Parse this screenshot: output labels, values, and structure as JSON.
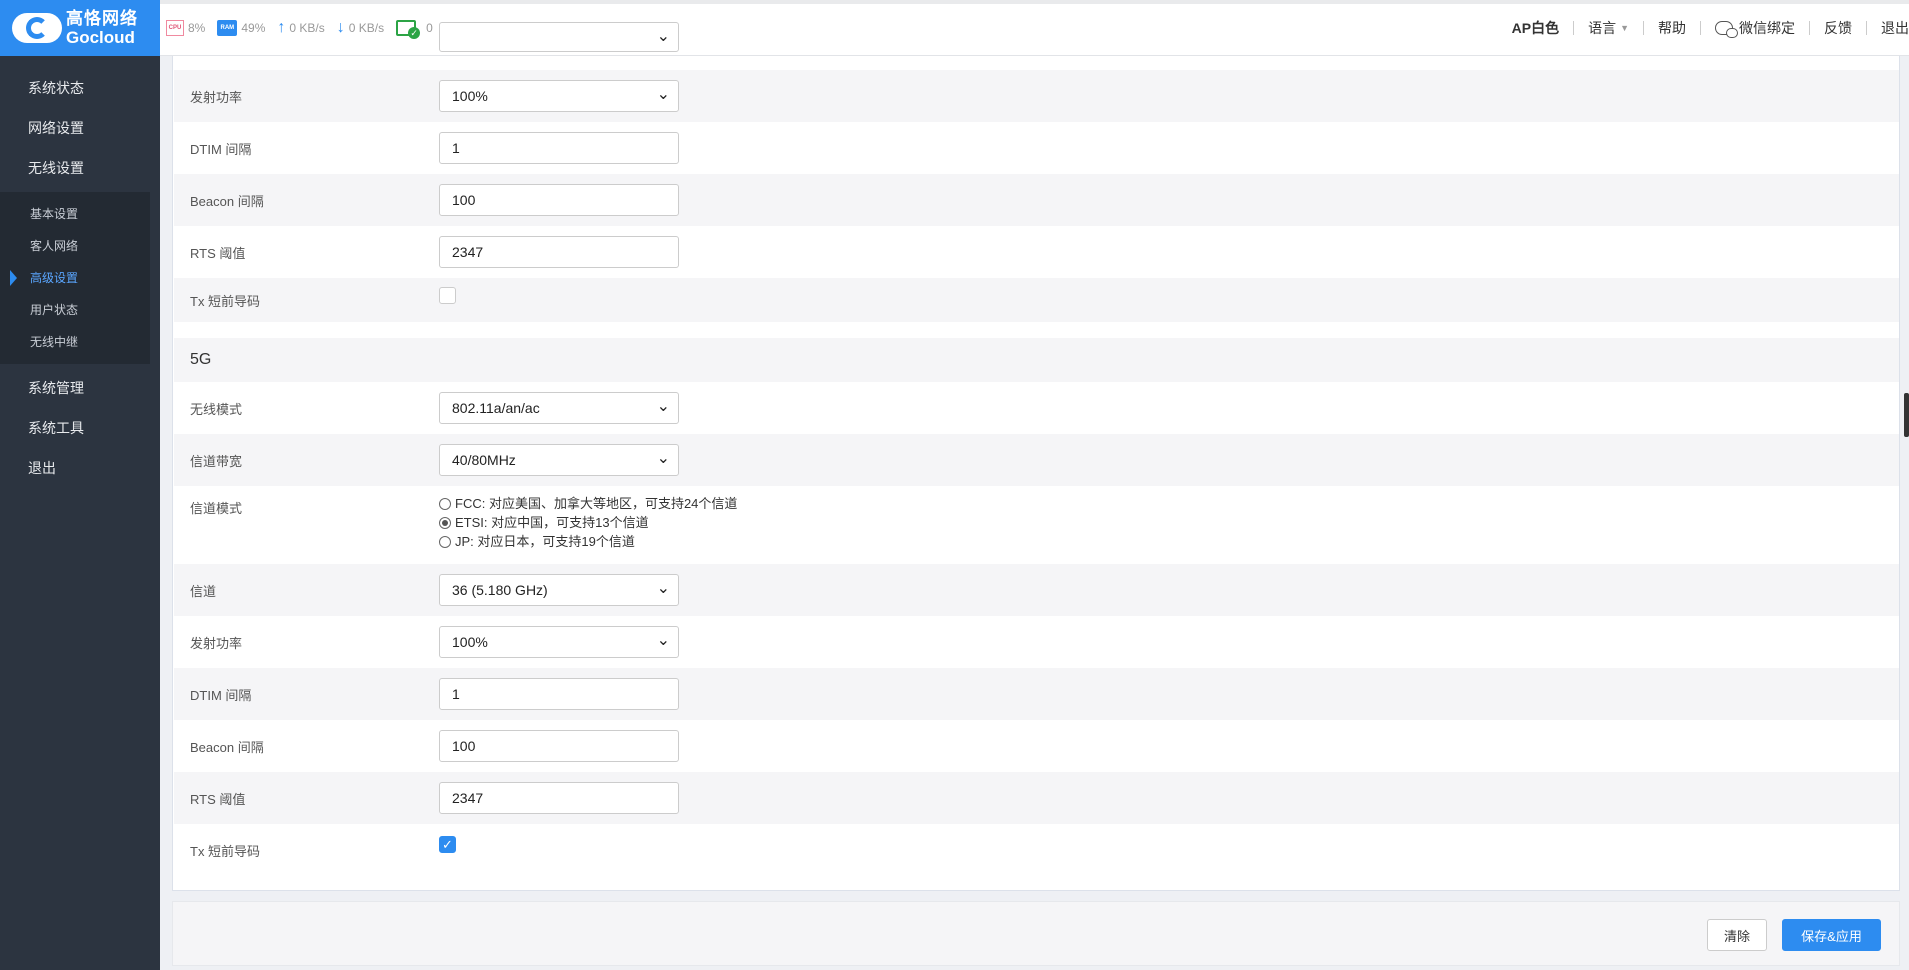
{
  "brand": {
    "name_cn": "高恪网络",
    "name_en": "Gocloud"
  },
  "stats": {
    "cpu_icon": "CPU",
    "cpu": "8%",
    "ram_icon": "RAM",
    "ram": "49%",
    "upload": "0 KB/s",
    "download": "0 KB/s",
    "devices": "0"
  },
  "topnav": {
    "theme": "AP白色",
    "language": "语言",
    "help": "帮助",
    "wechat": "微信绑定",
    "feedback": "反馈",
    "logout": "退出"
  },
  "sidebar": {
    "items": [
      {
        "label": "系统状态"
      },
      {
        "label": "网络设置"
      },
      {
        "label": "无线设置"
      }
    ],
    "subitems": [
      {
        "label": "基本设置"
      },
      {
        "label": "客人网络"
      },
      {
        "label": "高级设置",
        "active": true
      },
      {
        "label": "用户状态"
      },
      {
        "label": "无线中继"
      }
    ],
    "items_after": [
      {
        "label": "系统管理"
      },
      {
        "label": "系统工具"
      },
      {
        "label": "退出"
      }
    ]
  },
  "band24": {
    "tx_power": {
      "label": "发射功率",
      "value": "100%"
    },
    "dtim": {
      "label": "DTIM 间隔",
      "value": "1"
    },
    "beacon": {
      "label": "Beacon 间隔",
      "value": "100"
    },
    "rts": {
      "label": "RTS 阈值",
      "value": "2347"
    },
    "tx_preamble": {
      "label": "Tx 短前导码",
      "checked": false
    }
  },
  "band5": {
    "title": "5G",
    "mode": {
      "label": "无线模式",
      "value": "802.11a/an/ac"
    },
    "bandwidth": {
      "label": "信道带宽",
      "value": "40/80MHz"
    },
    "channel_mode": {
      "label": "信道模式",
      "options": [
        {
          "text": "FCC: 对应美国、加拿大等地区，可支持24个信道",
          "selected": false
        },
        {
          "text": "ETSI: 对应中国，可支持13个信道",
          "selected": true
        },
        {
          "text": "JP: 对应日本，可支持19个信道",
          "selected": false
        }
      ]
    },
    "channel": {
      "label": "信道",
      "value": "36 (5.180 GHz)"
    },
    "tx_power": {
      "label": "发射功率",
      "value": "100%"
    },
    "dtim": {
      "label": "DTIM 间隔",
      "value": "1"
    },
    "beacon": {
      "label": "Beacon 间隔",
      "value": "100"
    },
    "rts": {
      "label": "RTS 阈值",
      "value": "2347"
    },
    "tx_preamble": {
      "label": "Tx 短前导码",
      "checked": true
    }
  },
  "actions": {
    "clear": "清除",
    "save": "保存&应用"
  },
  "colors": {
    "accent": "#2d8cf0",
    "sidebar": "#2c3440"
  }
}
